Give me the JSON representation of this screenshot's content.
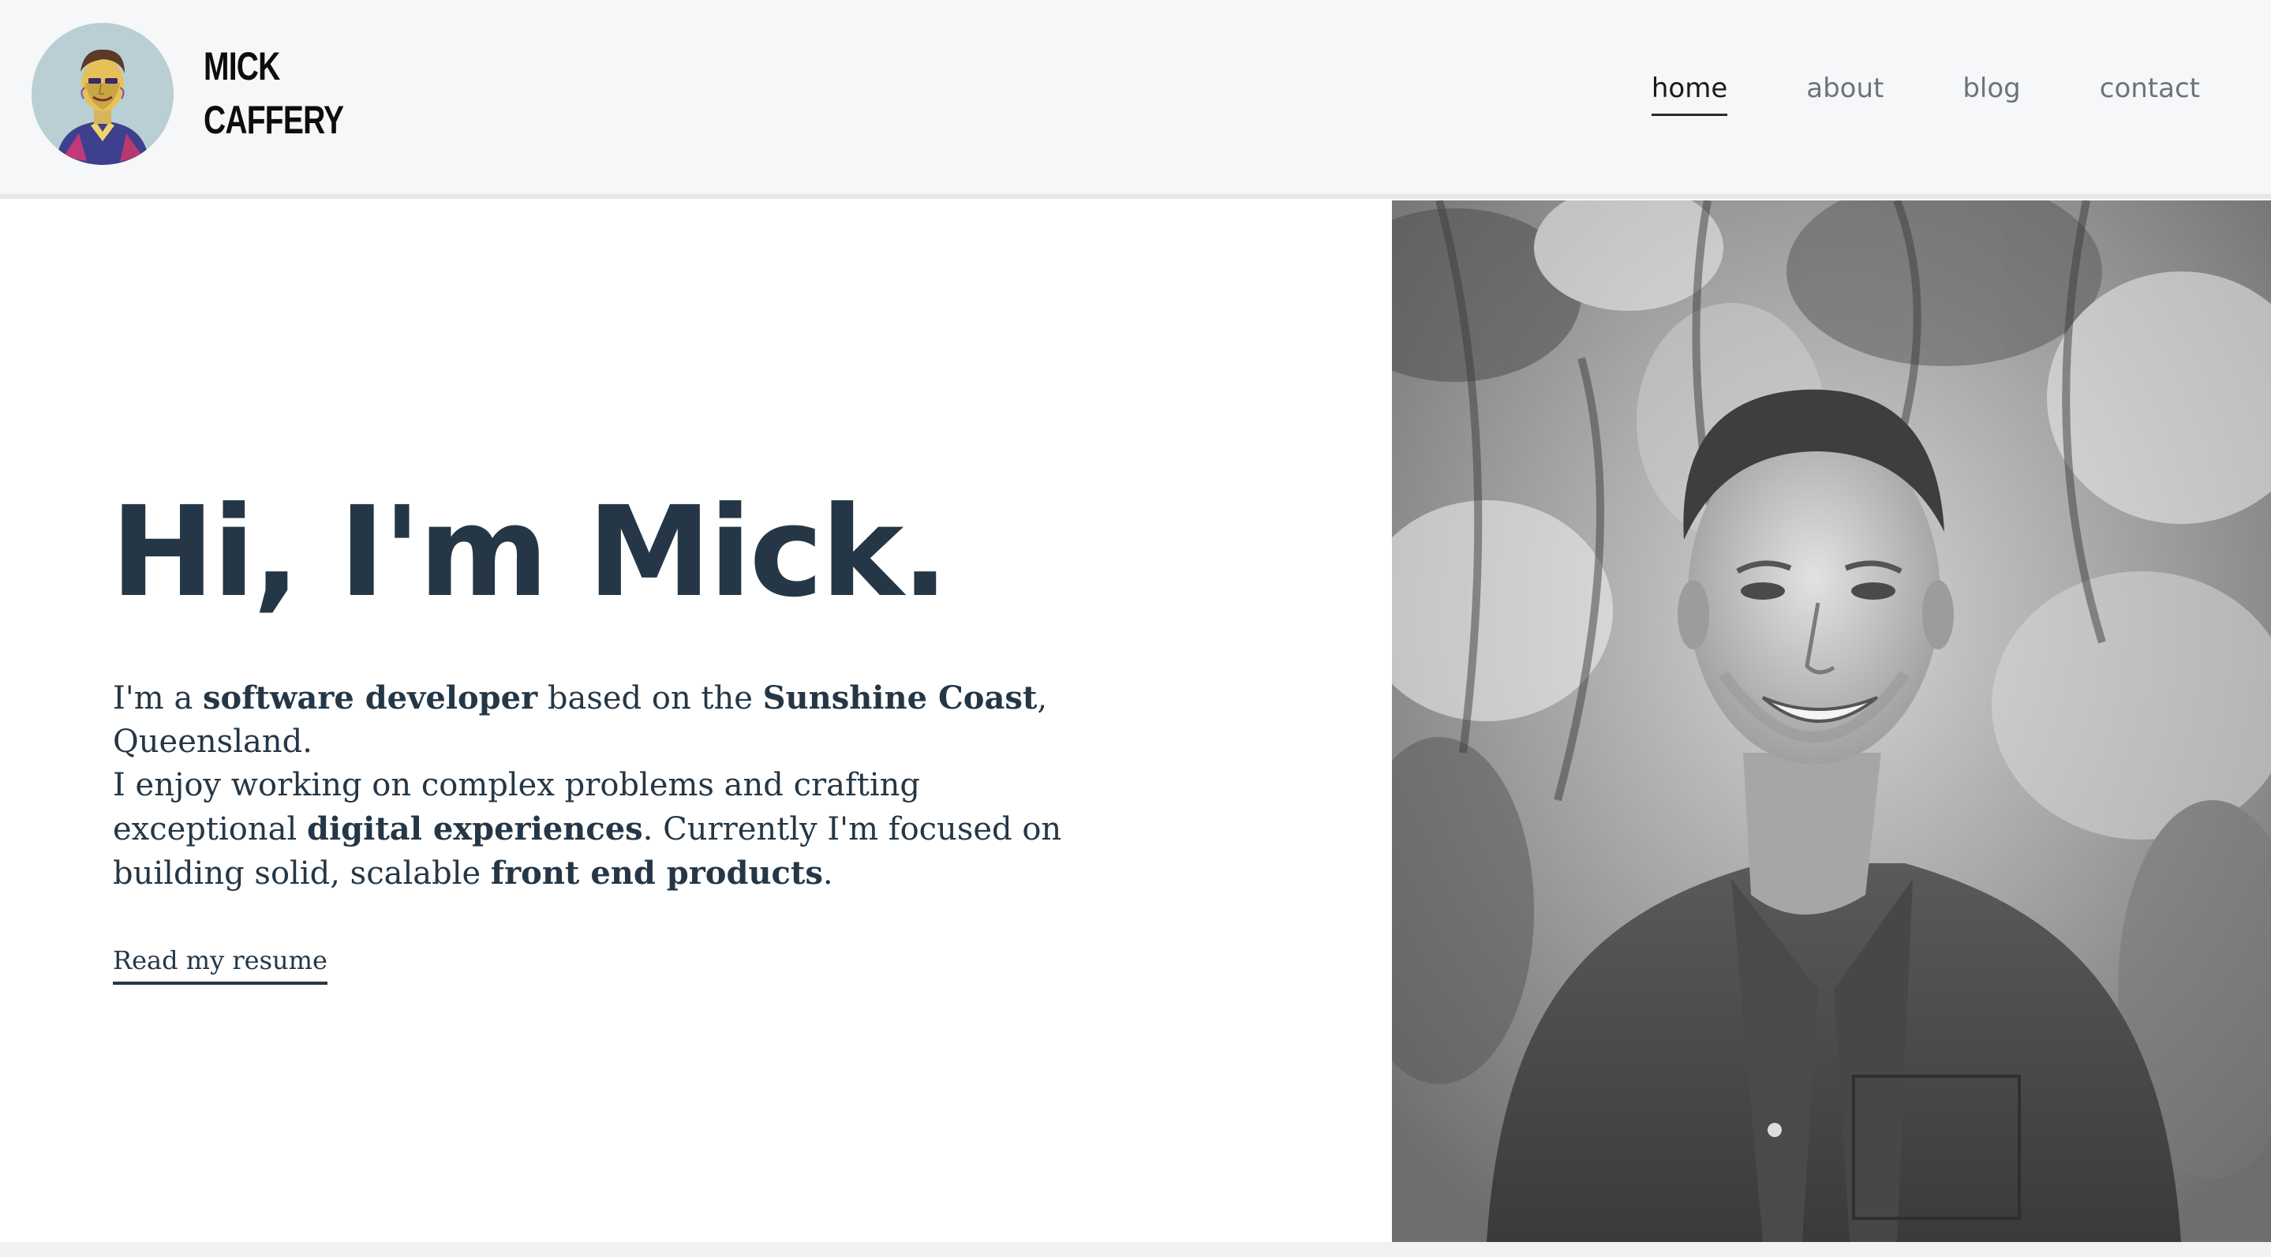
{
  "header": {
    "name_line1": "MICK",
    "name_line2": "CAFFERY",
    "avatar_alt": "avatar-illustration"
  },
  "nav": {
    "items": [
      {
        "label": "home",
        "active": true
      },
      {
        "label": "about",
        "active": false
      },
      {
        "label": "blog",
        "active": false
      },
      {
        "label": "contact",
        "active": false
      }
    ]
  },
  "hero": {
    "heading": "Hi, I'm Mick.",
    "bio": {
      "p1_a": "I'm a ",
      "p1_b": "software developer",
      "p1_c": " based on the ",
      "p1_d": "Sunshine Coast",
      "p1_e": ",",
      "p1_f": "Queensland.",
      "p2_a": "I enjoy working on complex problems and crafting",
      "p2_b": "exceptional ",
      "p2_c": "digital experiences",
      "p2_d": ". Currently I'm focused on",
      "p2_e": "building solid, scalable ",
      "p2_f": "front end products",
      "p2_g": "."
    },
    "resume_label": "Read my resume"
  },
  "colors": {
    "text": "#253746",
    "header_bg": "#f6f7f9",
    "nav_inactive": "#6f7378",
    "nav_active": "#1a1a1a"
  }
}
